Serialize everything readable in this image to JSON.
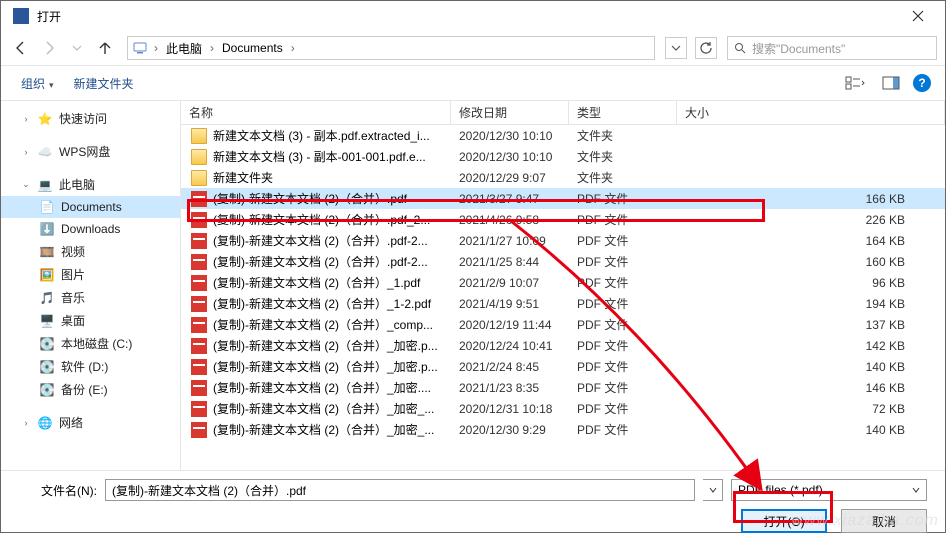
{
  "titlebar": {
    "title": "打开"
  },
  "breadcrumb": {
    "root": "此电脑",
    "folder": "Documents"
  },
  "search": {
    "placeholder": "搜索\"Documents\""
  },
  "toolbar": {
    "organize": "组织",
    "newfolder": "新建文件夹"
  },
  "sidebar": {
    "quick": "快速访问",
    "wps": "WPS网盘",
    "thispc": "此电脑",
    "docs": "Documents",
    "downloads": "Downloads",
    "videos": "视频",
    "pictures": "图片",
    "music": "音乐",
    "desktop": "桌面",
    "diskc": "本地磁盘 (C:)",
    "diskd": "软件 (D:)",
    "diske": "备份 (E:)",
    "network": "网络"
  },
  "columns": {
    "name": "名称",
    "date": "修改日期",
    "type": "类型",
    "size": "大小"
  },
  "files": [
    {
      "icon": "folder",
      "name": "新建文本文档 (3) - 副本.pdf.extracted_i...",
      "date": "2020/12/30 10:10",
      "type": "文件夹",
      "size": ""
    },
    {
      "icon": "folder",
      "name": "新建文本文档 (3) - 副本-001-001.pdf.e...",
      "date": "2020/12/30 10:10",
      "type": "文件夹",
      "size": ""
    },
    {
      "icon": "folder",
      "name": "新建文件夹",
      "date": "2020/12/29 9:07",
      "type": "文件夹",
      "size": ""
    },
    {
      "icon": "pdf",
      "name": "(复制)-新建文本文档 (2)（合并）.pdf",
      "date": "2021/3/27 9:47",
      "type": "PDF 文件",
      "size": "166 KB",
      "selected": true
    },
    {
      "icon": "pdf",
      "name": "(复制)-新建文本文档 (2)（合并）.pdf_2...",
      "date": "2021/4/26 9:58",
      "type": "PDF 文件",
      "size": "226 KB"
    },
    {
      "icon": "pdf",
      "name": "(复制)-新建文本文档 (2)（合并）.pdf-2...",
      "date": "2021/1/27 10:09",
      "type": "PDF 文件",
      "size": "164 KB"
    },
    {
      "icon": "pdf",
      "name": "(复制)-新建文本文档 (2)（合并）.pdf-2...",
      "date": "2021/1/25 8:44",
      "type": "PDF 文件",
      "size": "160 KB"
    },
    {
      "icon": "pdf",
      "name": "(复制)-新建文本文档 (2)（合并）_1.pdf",
      "date": "2021/2/9 10:07",
      "type": "PDF 文件",
      "size": "96 KB"
    },
    {
      "icon": "pdf",
      "name": "(复制)-新建文本文档 (2)（合并）_1-2.pdf",
      "date": "2021/4/19 9:51",
      "type": "PDF 文件",
      "size": "194 KB"
    },
    {
      "icon": "pdf",
      "name": "(复制)-新建文本文档 (2)（合并）_comp...",
      "date": "2020/12/19 11:44",
      "type": "PDF 文件",
      "size": "137 KB"
    },
    {
      "icon": "pdf",
      "name": "(复制)-新建文本文档 (2)（合并）_加密.p...",
      "date": "2020/12/24 10:41",
      "type": "PDF 文件",
      "size": "142 KB"
    },
    {
      "icon": "pdf",
      "name": "(复制)-新建文本文档 (2)（合并）_加密.p...",
      "date": "2021/2/24 8:45",
      "type": "PDF 文件",
      "size": "140 KB"
    },
    {
      "icon": "pdf",
      "name": "(复制)-新建文本文档 (2)（合并）_加密....",
      "date": "2021/1/23 8:35",
      "type": "PDF 文件",
      "size": "146 KB"
    },
    {
      "icon": "pdf",
      "name": "(复制)-新建文本文档 (2)（合并）_加密_...",
      "date": "2020/12/31 10:18",
      "type": "PDF 文件",
      "size": "72 KB"
    },
    {
      "icon": "pdf",
      "name": "(复制)-新建文本文档 (2)（合并）_加密_...",
      "date": "2020/12/30 9:29",
      "type": "PDF 文件",
      "size": "140 KB"
    }
  ],
  "footer": {
    "filename_label": "文件名(N):",
    "filename_value": "(复制)-新建文本文档 (2)（合并）.pdf",
    "filter": "PDF files (*.pdf)",
    "open": "打开(O)",
    "cancel": "取消"
  },
  "watermark": "www.xiazaiba.com"
}
